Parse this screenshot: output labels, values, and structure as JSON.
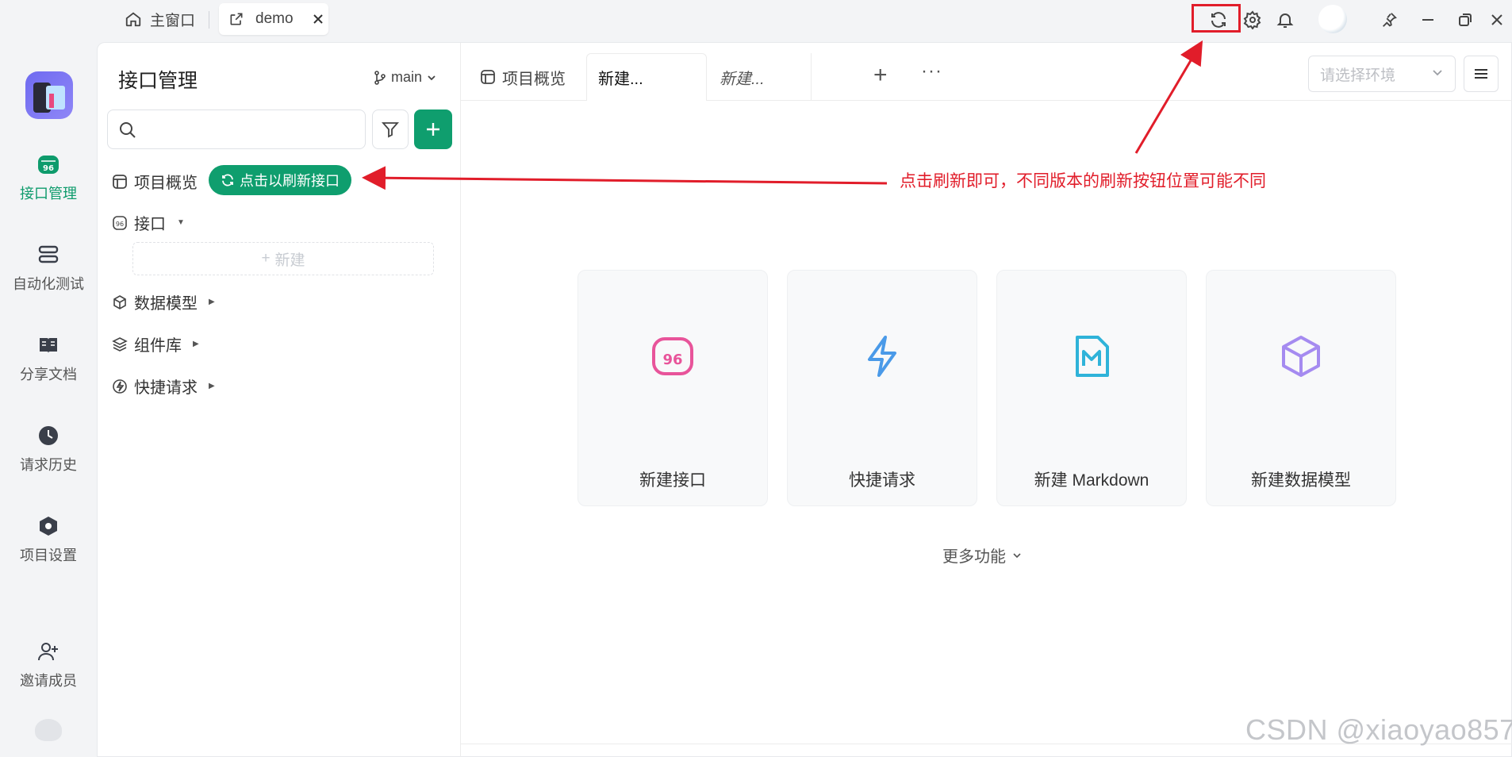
{
  "titlebar": {
    "home_label": "主窗口",
    "demo_label": "demo"
  },
  "rail": {
    "items": [
      {
        "label": "接口管理"
      },
      {
        "label": "自动化测试"
      },
      {
        "label": "分享文档"
      },
      {
        "label": "请求历史"
      },
      {
        "label": "项目设置"
      },
      {
        "label": "邀请成员"
      }
    ]
  },
  "tree": {
    "title": "接口管理",
    "branch": "main",
    "refresh_label": "点击以刷新接口",
    "items": [
      {
        "label": "项目概览"
      },
      {
        "label": "接口"
      },
      {
        "label": "数据模型"
      },
      {
        "label": "组件库"
      },
      {
        "label": "快捷请求"
      }
    ],
    "new_label": "新建"
  },
  "tabs": {
    "overview": "项目概览",
    "tab1": "新建...",
    "tab2": "新建..."
  },
  "env": {
    "placeholder": "请选择环境"
  },
  "cards": [
    {
      "label": "新建接口"
    },
    {
      "label": "快捷请求"
    },
    {
      "label": "新建 Markdown"
    },
    {
      "label": "新建数据模型"
    }
  ],
  "more": "更多功能",
  "annotation": "点击刷新即可，不同版本的刷新按钮位置可能不同",
  "watermark": "CSDN @xiaoyao857",
  "colors": {
    "accent": "#0f9e6e",
    "annotation": "#e11d2a"
  }
}
